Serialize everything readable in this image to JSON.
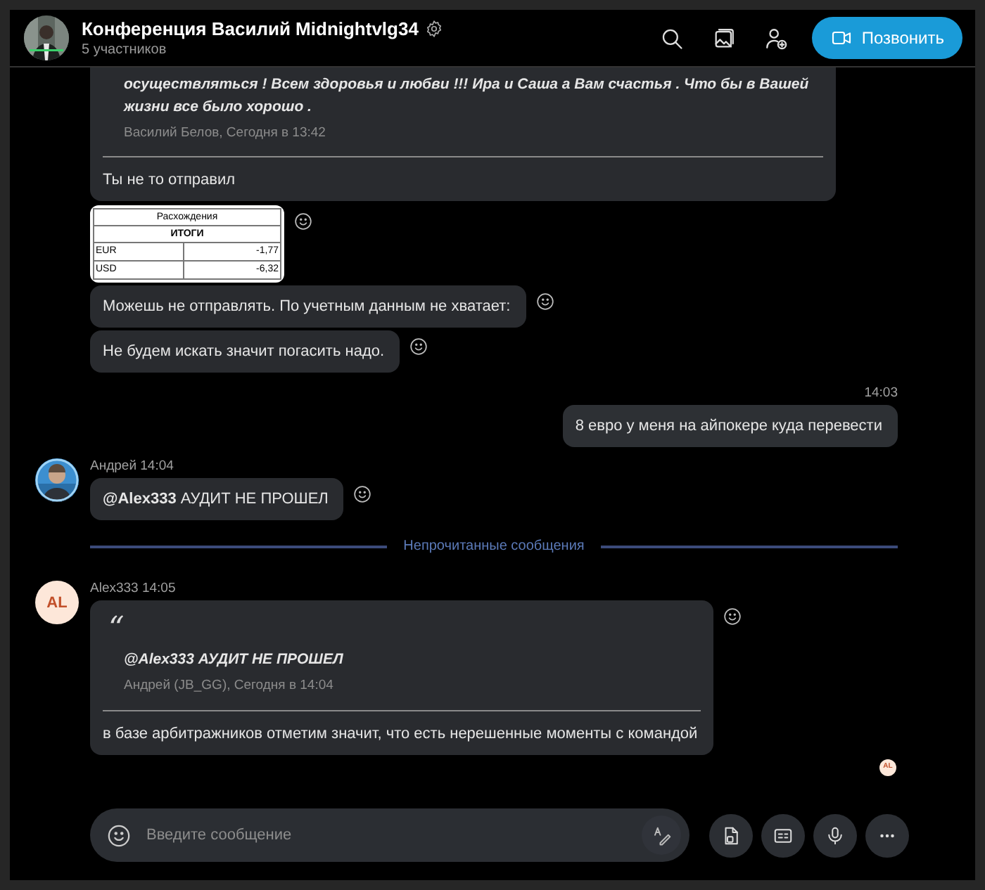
{
  "header": {
    "title": "Конференция Василий Midnightvlg34",
    "subtitle": "5 участников",
    "call_button": "Позвонить"
  },
  "messages": [
    {
      "kind": "quote",
      "quote_text": "осуществляться ! Всем здоровья и любви !!! Ира и Саша а Вам счастья . Что бы в Вашей\nжизни все было хорошо .",
      "quote_meta": "Василий Белов, Сегодня в 13:42",
      "text": "Ты не то отправил",
      "reaction_button": false
    },
    {
      "kind": "table",
      "table": {
        "title": "Расхождения",
        "subtitle": "ИТОГИ",
        "rows": [
          [
            "EUR",
            "-1,77"
          ],
          [
            "USD",
            "-6,32"
          ]
        ]
      },
      "reaction_button": true
    },
    {
      "kind": "text",
      "text": "Можешь не отправлять. По учетным данным не хватает:",
      "reaction_button": true
    },
    {
      "kind": "text",
      "text": "Не будем искать значит погасить надо.",
      "reaction_button": true
    },
    {
      "kind": "outgoing",
      "time": "14:03",
      "text": "8 евро у меня на айпокере куда перевести",
      "reaction_button": false
    },
    {
      "kind": "text",
      "sender": "Андрей",
      "time": "14:04",
      "text": "**@Alex333** АУДИТ НЕ ПРОШЕЛ",
      "reaction_button": true
    },
    {
      "kind": "divider",
      "text": "Непрочитанные сообщения"
    },
    {
      "kind": "quote",
      "sender": "Alex333",
      "time": "14:05",
      "initials": "AL",
      "quote_mark": "“",
      "quote_text": "**@Alex333** АУДИТ НЕ ПРОШЕЛ",
      "quote_meta": "Андрей (JB_GG), Сегодня в 14:04",
      "text": "в базе арбитражников отметим значит, что есть нерешенные моменты с командой",
      "reaction_button": true
    }
  ],
  "read_receipt": {
    "initials": "AL"
  },
  "composer": {
    "placeholder": "Введите сообщение"
  }
}
